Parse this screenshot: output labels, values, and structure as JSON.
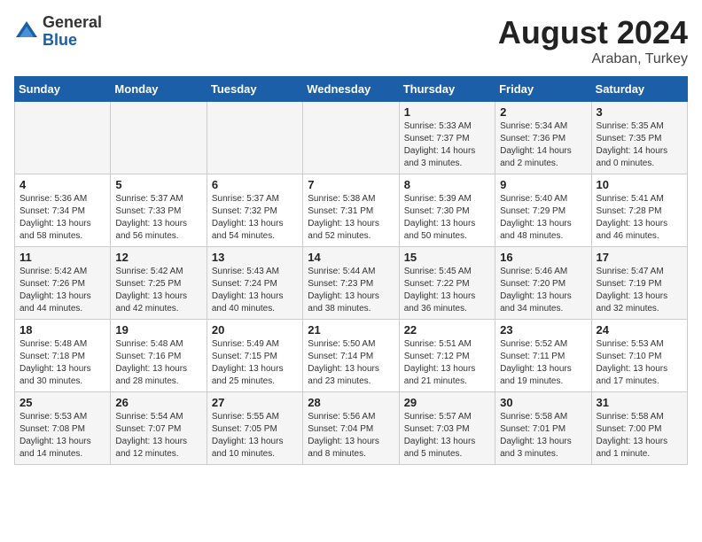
{
  "logo": {
    "general": "General",
    "blue": "Blue"
  },
  "title": "August 2024",
  "location": "Araban, Turkey",
  "days_of_week": [
    "Sunday",
    "Monday",
    "Tuesday",
    "Wednesday",
    "Thursday",
    "Friday",
    "Saturday"
  ],
  "weeks": [
    [
      {
        "day": "",
        "info": ""
      },
      {
        "day": "",
        "info": ""
      },
      {
        "day": "",
        "info": ""
      },
      {
        "day": "",
        "info": ""
      },
      {
        "day": "1",
        "info": "Sunrise: 5:33 AM\nSunset: 7:37 PM\nDaylight: 14 hours\nand 3 minutes."
      },
      {
        "day": "2",
        "info": "Sunrise: 5:34 AM\nSunset: 7:36 PM\nDaylight: 14 hours\nand 2 minutes."
      },
      {
        "day": "3",
        "info": "Sunrise: 5:35 AM\nSunset: 7:35 PM\nDaylight: 14 hours\nand 0 minutes."
      }
    ],
    [
      {
        "day": "4",
        "info": "Sunrise: 5:36 AM\nSunset: 7:34 PM\nDaylight: 13 hours\nand 58 minutes."
      },
      {
        "day": "5",
        "info": "Sunrise: 5:37 AM\nSunset: 7:33 PM\nDaylight: 13 hours\nand 56 minutes."
      },
      {
        "day": "6",
        "info": "Sunrise: 5:37 AM\nSunset: 7:32 PM\nDaylight: 13 hours\nand 54 minutes."
      },
      {
        "day": "7",
        "info": "Sunrise: 5:38 AM\nSunset: 7:31 PM\nDaylight: 13 hours\nand 52 minutes."
      },
      {
        "day": "8",
        "info": "Sunrise: 5:39 AM\nSunset: 7:30 PM\nDaylight: 13 hours\nand 50 minutes."
      },
      {
        "day": "9",
        "info": "Sunrise: 5:40 AM\nSunset: 7:29 PM\nDaylight: 13 hours\nand 48 minutes."
      },
      {
        "day": "10",
        "info": "Sunrise: 5:41 AM\nSunset: 7:28 PM\nDaylight: 13 hours\nand 46 minutes."
      }
    ],
    [
      {
        "day": "11",
        "info": "Sunrise: 5:42 AM\nSunset: 7:26 PM\nDaylight: 13 hours\nand 44 minutes."
      },
      {
        "day": "12",
        "info": "Sunrise: 5:42 AM\nSunset: 7:25 PM\nDaylight: 13 hours\nand 42 minutes."
      },
      {
        "day": "13",
        "info": "Sunrise: 5:43 AM\nSunset: 7:24 PM\nDaylight: 13 hours\nand 40 minutes."
      },
      {
        "day": "14",
        "info": "Sunrise: 5:44 AM\nSunset: 7:23 PM\nDaylight: 13 hours\nand 38 minutes."
      },
      {
        "day": "15",
        "info": "Sunrise: 5:45 AM\nSunset: 7:22 PM\nDaylight: 13 hours\nand 36 minutes."
      },
      {
        "day": "16",
        "info": "Sunrise: 5:46 AM\nSunset: 7:20 PM\nDaylight: 13 hours\nand 34 minutes."
      },
      {
        "day": "17",
        "info": "Sunrise: 5:47 AM\nSunset: 7:19 PM\nDaylight: 13 hours\nand 32 minutes."
      }
    ],
    [
      {
        "day": "18",
        "info": "Sunrise: 5:48 AM\nSunset: 7:18 PM\nDaylight: 13 hours\nand 30 minutes."
      },
      {
        "day": "19",
        "info": "Sunrise: 5:48 AM\nSunset: 7:16 PM\nDaylight: 13 hours\nand 28 minutes."
      },
      {
        "day": "20",
        "info": "Sunrise: 5:49 AM\nSunset: 7:15 PM\nDaylight: 13 hours\nand 25 minutes."
      },
      {
        "day": "21",
        "info": "Sunrise: 5:50 AM\nSunset: 7:14 PM\nDaylight: 13 hours\nand 23 minutes."
      },
      {
        "day": "22",
        "info": "Sunrise: 5:51 AM\nSunset: 7:12 PM\nDaylight: 13 hours\nand 21 minutes."
      },
      {
        "day": "23",
        "info": "Sunrise: 5:52 AM\nSunset: 7:11 PM\nDaylight: 13 hours\nand 19 minutes."
      },
      {
        "day": "24",
        "info": "Sunrise: 5:53 AM\nSunset: 7:10 PM\nDaylight: 13 hours\nand 17 minutes."
      }
    ],
    [
      {
        "day": "25",
        "info": "Sunrise: 5:53 AM\nSunset: 7:08 PM\nDaylight: 13 hours\nand 14 minutes."
      },
      {
        "day": "26",
        "info": "Sunrise: 5:54 AM\nSunset: 7:07 PM\nDaylight: 13 hours\nand 12 minutes."
      },
      {
        "day": "27",
        "info": "Sunrise: 5:55 AM\nSunset: 7:05 PM\nDaylight: 13 hours\nand 10 minutes."
      },
      {
        "day": "28",
        "info": "Sunrise: 5:56 AM\nSunset: 7:04 PM\nDaylight: 13 hours\nand 8 minutes."
      },
      {
        "day": "29",
        "info": "Sunrise: 5:57 AM\nSunset: 7:03 PM\nDaylight: 13 hours\nand 5 minutes."
      },
      {
        "day": "30",
        "info": "Sunrise: 5:58 AM\nSunset: 7:01 PM\nDaylight: 13 hours\nand 3 minutes."
      },
      {
        "day": "31",
        "info": "Sunrise: 5:58 AM\nSunset: 7:00 PM\nDaylight: 13 hours\nand 1 minute."
      }
    ]
  ]
}
